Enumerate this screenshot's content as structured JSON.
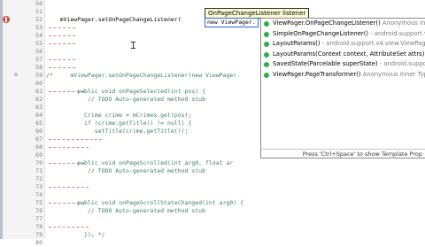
{
  "editor": {
    "lines": [
      {
        "n": "50",
        "code": "",
        "dash": 0
      },
      {
        "n": "51",
        "code": "",
        "dash": 0
      },
      {
        "n": "52",
        "code": "    mViewPager.setOnPageChangeListener(",
        "dash": 0,
        "error": true
      },
      {
        "n": "53",
        "code": "",
        "dash": 30
      },
      {
        "n": "54",
        "code": "",
        "dash": 30
      },
      {
        "n": "55",
        "code": "",
        "dash": 30
      },
      {
        "n": "56",
        "code": "",
        "dash": 0
      },
      {
        "n": "57",
        "code": "",
        "dash": 30
      },
      {
        "n": "58",
        "code": "",
        "dash": 30
      },
      {
        "n": "59",
        "code": "/*     mViewPager.setOnPageChangeListener(new ViewPager.",
        "dash": 0,
        "fold": "⊖",
        "comment": true
      },
      {
        "n": "60",
        "code": "",
        "dash": 0
      },
      {
        "n": "61",
        "code": "         public void onPageSelected(int pos) {",
        "dash": 40,
        "comment": true
      },
      {
        "n": "62",
        "code": "            // TODO Auto-generated method stub",
        "dash": 0,
        "comment": true
      },
      {
        "n": "63",
        "code": "",
        "dash": 0
      },
      {
        "n": "64",
        "code": "           Crime crime = mCrimes.get(pos);",
        "dash": 0,
        "comment": true
      },
      {
        "n": "65",
        "code": "           if (crime.getTitle() != null) {",
        "dash": 0,
        "comment": true
      },
      {
        "n": "66",
        "code": "              setTitle(crime.getTitle());",
        "dash": 0,
        "comment": true
      },
      {
        "n": "67",
        "code": "",
        "dash": 60
      },
      {
        "n": "68",
        "code": "",
        "dash": 45
      },
      {
        "n": "69",
        "code": "",
        "dash": 0
      },
      {
        "n": "70",
        "code": "         public void onPageScrolled(int arg0, float ar",
        "dash": 40,
        "comment": true
      },
      {
        "n": "71",
        "code": "            // TODO Auto-generated method stub",
        "dash": 0,
        "comment": true
      },
      {
        "n": "72",
        "code": "",
        "dash": 0
      },
      {
        "n": "73",
        "code": "",
        "dash": 45
      },
      {
        "n": "74",
        "code": "",
        "dash": 0
      },
      {
        "n": "75",
        "code": "         public void onPageScrollStateChanged(int arg0) {",
        "dash": 40,
        "comment": true
      },
      {
        "n": "76",
        "code": "            // TODO Auto-generated method stub",
        "dash": 0,
        "comment": true
      },
      {
        "n": "77",
        "code": "",
        "dash": 0
      },
      {
        "n": "78",
        "code": "",
        "dash": 45
      },
      {
        "n": "79",
        "code": "           }); */",
        "dash": 0,
        "comment": true
      },
      {
        "n": "80",
        "code": "",
        "dash": 0
      }
    ]
  },
  "tooltip": {
    "text": "OnPageChangeListener listener"
  },
  "typed": {
    "text": "new ViewPager."
  },
  "popup": {
    "items": [
      {
        "main": "ViewPager.OnPageChangeListener()",
        "sub": " Anonymous Inne"
      },
      {
        "main": "SimpleOnPageChangeListener()",
        "sub": " - android.support.v4.vi"
      },
      {
        "main": "LayoutParams()",
        "sub": " - android.support.v4.view.ViewPager.L"
      },
      {
        "main": "LayoutParams(Context context, AttributeSet attrs)",
        "sub": " - andr"
      },
      {
        "main": "SavedState(Parcelable superState)",
        "sub": " - android.support.v4"
      },
      {
        "main": "ViewPager.PageTransformer()",
        "sub": " Anonymous Inner Type"
      }
    ],
    "footer": "Press 'Ctrl+Space' to show Template Prop"
  },
  "colors": {
    "comment": "#3f7f5f",
    "keyword": "#7f0055",
    "selection": "#dbe7fb",
    "error": "#e0463f"
  }
}
